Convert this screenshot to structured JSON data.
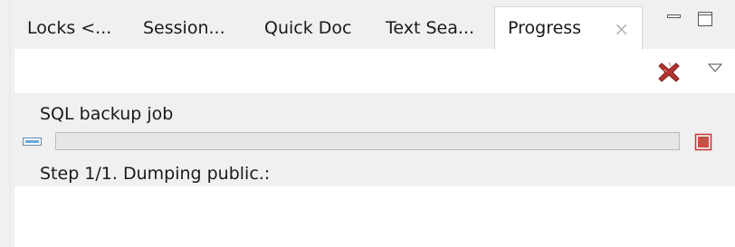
{
  "tabs": [
    {
      "label": "Locks <..."
    },
    {
      "label": "Session..."
    },
    {
      "label": "Quick Doc"
    },
    {
      "label": "Text Sea..."
    },
    {
      "label": "Progress",
      "close": "×"
    }
  ],
  "icons": {
    "minimize": "minimize-icon",
    "maximize": "maximize-icon",
    "remove_all": "remove-all-finished-icon",
    "view_menu": "view-menu-chevron-icon",
    "job": "job-icon",
    "cancel": "cancel-job-icon"
  },
  "colors": {
    "accent_red": "#c8332f",
    "job_icon_blue": "#6aa8d8"
  },
  "job": {
    "title": "SQL backup job",
    "status": "Step 1/1. Dumping public.:",
    "progress": 0
  }
}
